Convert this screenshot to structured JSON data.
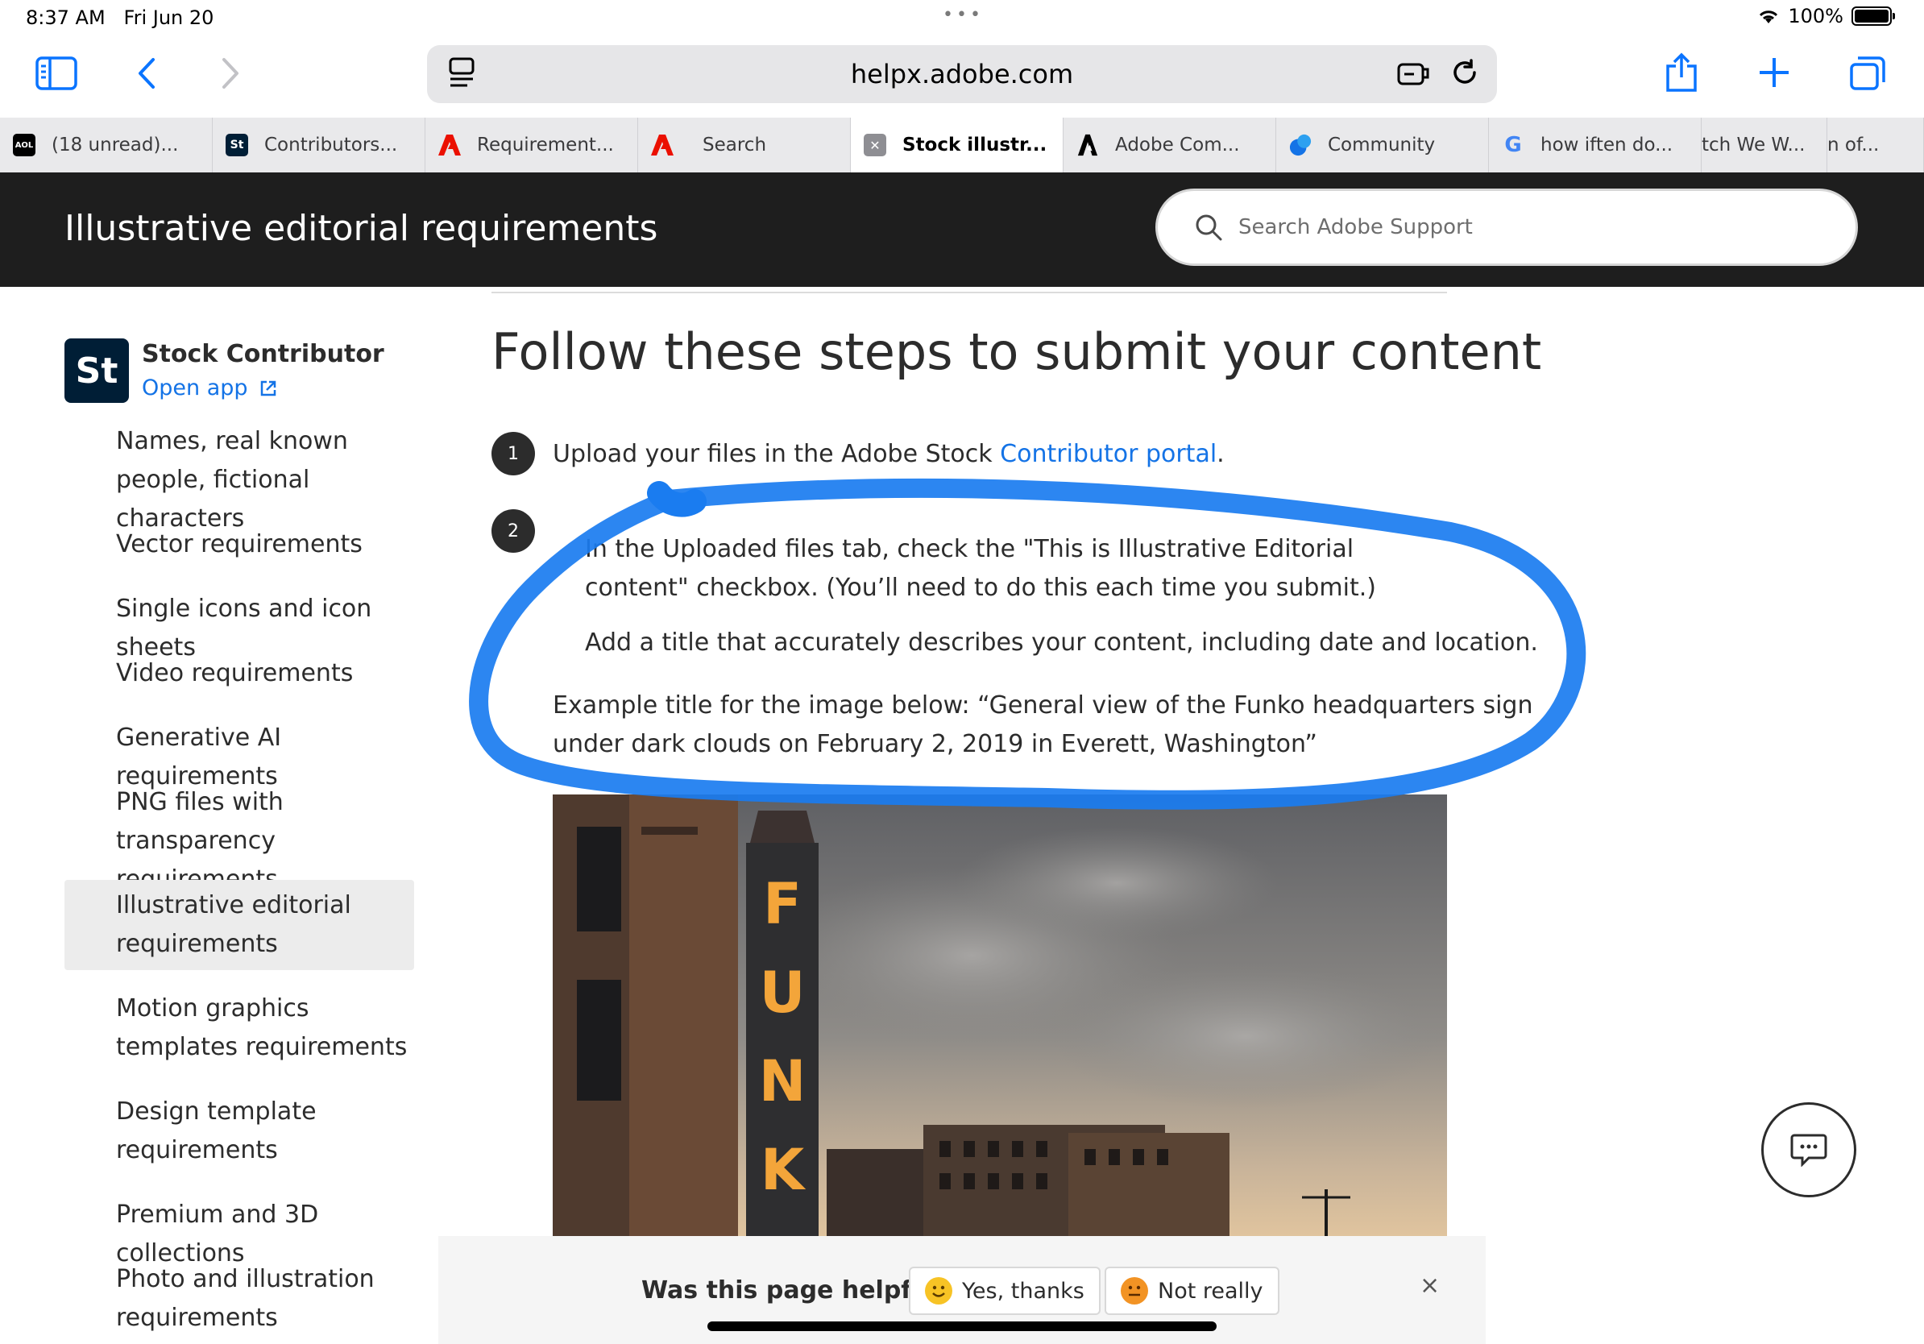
{
  "status_bar": {
    "time": "8:37 AM",
    "date": "Fri Jun 20",
    "battery": "100%"
  },
  "address_bar": {
    "url": "helpx.adobe.com"
  },
  "tabs": [
    {
      "label": "(18 unread)...",
      "icon": "aol-icon"
    },
    {
      "label": "Contributors...",
      "icon": "adobe-stock-icon"
    },
    {
      "label": "Requirement...",
      "icon": "adobe-icon"
    },
    {
      "label": "Search",
      "icon": "adobe-icon"
    },
    {
      "label": "Stock illustr...",
      "icon": "close-icon",
      "active": true
    },
    {
      "label": "Adobe Com...",
      "icon": "adobe-community-icon"
    },
    {
      "label": "Community",
      "icon": "community-icon"
    },
    {
      "label": "how iften do...",
      "icon": "google-icon"
    },
    {
      "label": "tch We W...",
      "icon": ""
    },
    {
      "label": "n of...",
      "icon": ""
    }
  ],
  "header": {
    "title": "Illustrative editorial requirements",
    "search_placeholder": "Search Adobe Support"
  },
  "sidebar": {
    "logo": "St",
    "product": "Stock Contributor",
    "open_app": "Open app",
    "items": [
      {
        "label": "Names, real known people, fictional characters"
      },
      {
        "label": "Vector requirements"
      },
      {
        "label": "Single icons and icon sheets"
      },
      {
        "label": "Video requirements"
      },
      {
        "label": "Generative AI requirements"
      },
      {
        "label": "PNG files with transparency requirements"
      },
      {
        "label": "Illustrative editorial requirements",
        "active": true
      },
      {
        "label": "Motion graphics templates requirements"
      },
      {
        "label": "Design template requirements"
      },
      {
        "label": "Premium and 3D collections"
      },
      {
        "label": "Photo and illustration requirements"
      }
    ]
  },
  "main": {
    "heading": "Follow these steps to submit your content",
    "step1": {
      "number": "1",
      "text": "Upload your files in the Adobe Stock ",
      "link": "Contributor portal",
      "suffix": "."
    },
    "step2": {
      "number": "2",
      "line1": "In the Uploaded files tab, check the \"This is Illustrative Editorial",
      "line2": "content\" checkbox. (You’ll need to do this each time you submit.)",
      "line3": "Add a title that accurately describes your content, including date and location."
    },
    "example": {
      "line1": "Example title for the image below: “General view of the Funko headquarters sign",
      "line2": "under dark clouds on February 2, 2019 in Everett, Washington”"
    },
    "photo_sign": [
      "F",
      "U",
      "N",
      "K"
    ]
  },
  "feedback": {
    "question": "Was this page helpful?",
    "yes": "Yes, thanks",
    "no": "Not really",
    "close": "×"
  },
  "colors": {
    "accent": "#1473e6",
    "header_bg": "#1e1e1e",
    "ink": "#1a7cf0",
    "safari_blue": "#0a74ff"
  }
}
